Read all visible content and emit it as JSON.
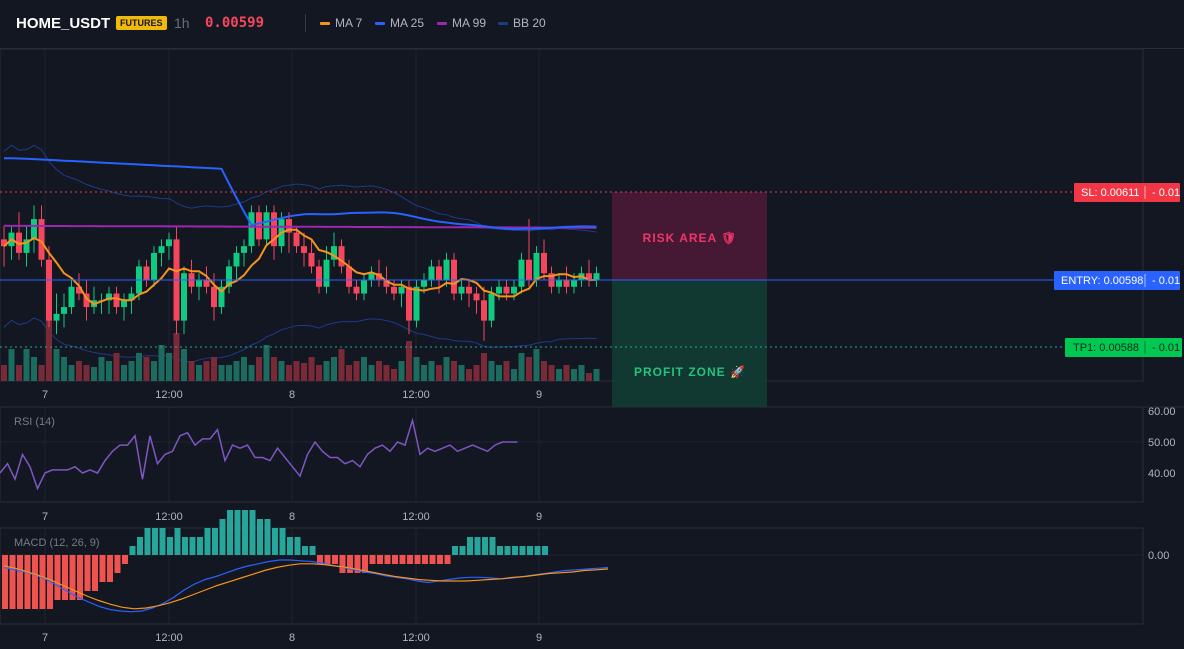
{
  "header": {
    "symbol": "HOME_USDT",
    "badge": "FUTURES",
    "timeframe": "1h",
    "price": "0.00599",
    "legend": [
      {
        "label": "MA 7",
        "color": "#f7931a"
      },
      {
        "label": "MA 25",
        "color": "#2962ff"
      },
      {
        "label": "MA 99",
        "color": "#9c27b0"
      },
      {
        "label": "BB 20",
        "color": "#1e3a8a"
      }
    ]
  },
  "levels": {
    "sl": {
      "label": "SL: 0.00611",
      "qty": "0.01",
      "value": 0.00611,
      "color": "#f23645"
    },
    "entry": {
      "label": "ENTRY: 0.00598",
      "qty": "0.01",
      "value": 0.00598,
      "color": "#2962ff"
    },
    "tp1": {
      "label": "TP1: 0.00588",
      "qty": "0.01",
      "value": 0.00588,
      "color": "#00c853"
    }
  },
  "zones": {
    "risk_label": "RISK AREA 🛡",
    "profit_label": "PROFIT ZONE 🚀"
  },
  "time_axis": [
    "7",
    "12:00",
    "8",
    "12:00",
    "9"
  ],
  "rsi_panel": {
    "title": "RSI (14)",
    "ticks": [
      "60.00",
      "50.00",
      "40.00"
    ]
  },
  "macd_panel": {
    "title": "MACD (12, 26, 9)",
    "ticks": [
      "0.00"
    ]
  },
  "chart_data": {
    "type": "candlestick",
    "price_range": [
      0.00578,
      0.00634
    ],
    "candles": [
      [
        0.00604,
        0.00606,
        0.006,
        0.00603
      ],
      [
        0.00603,
        0.00606,
        0.00601,
        0.00605
      ],
      [
        0.00605,
        0.00608,
        0.00601,
        0.00602
      ],
      [
        0.00602,
        0.00606,
        0.006,
        0.00604
      ],
      [
        0.00604,
        0.00609,
        0.00602,
        0.00607
      ],
      [
        0.00607,
        0.00609,
        0.006,
        0.00601
      ],
      [
        0.00601,
        0.00603,
        0.00591,
        0.00592
      ],
      [
        0.00592,
        0.00596,
        0.0059,
        0.00593
      ],
      [
        0.00593,
        0.00596,
        0.00591,
        0.00594
      ],
      [
        0.00594,
        0.00598,
        0.00593,
        0.00597
      ],
      [
        0.00597,
        0.00599,
        0.00595,
        0.00596
      ],
      [
        0.00596,
        0.00598,
        0.00592,
        0.00594
      ],
      [
        0.00594,
        0.00597,
        0.00593,
        0.00595
      ],
      [
        0.00595,
        0.00596,
        0.00593,
        0.00595
      ],
      [
        0.00595,
        0.00597,
        0.00593,
        0.00596
      ],
      [
        0.00596,
        0.00597,
        0.00593,
        0.00594
      ],
      [
        0.00594,
        0.00596,
        0.00592,
        0.00595
      ],
      [
        0.00595,
        0.00597,
        0.00593,
        0.00596
      ],
      [
        0.00596,
        0.00601,
        0.00595,
        0.006
      ],
      [
        0.006,
        0.00601,
        0.00597,
        0.00598
      ],
      [
        0.00598,
        0.00603,
        0.00597,
        0.00602
      ],
      [
        0.00602,
        0.00604,
        0.006,
        0.00603
      ],
      [
        0.00603,
        0.00605,
        0.00601,
        0.00604
      ],
      [
        0.00604,
        0.00606,
        0.0059,
        0.00592
      ],
      [
        0.00592,
        0.006,
        0.0059,
        0.00599
      ],
      [
        0.00599,
        0.00601,
        0.00596,
        0.00597
      ],
      [
        0.00597,
        0.00599,
        0.00595,
        0.00598
      ],
      [
        0.00598,
        0.006,
        0.00596,
        0.00597
      ],
      [
        0.00597,
        0.00599,
        0.00592,
        0.00594
      ],
      [
        0.00594,
        0.00598,
        0.00593,
        0.00597
      ],
      [
        0.00597,
        0.00601,
        0.00596,
        0.006
      ],
      [
        0.006,
        0.00603,
        0.00598,
        0.00602
      ],
      [
        0.00602,
        0.00604,
        0.006,
        0.00603
      ],
      [
        0.00603,
        0.00609,
        0.00602,
        0.00608
      ],
      [
        0.00608,
        0.00609,
        0.00603,
        0.00604
      ],
      [
        0.00604,
        0.00609,
        0.00603,
        0.00608
      ],
      [
        0.00608,
        0.00609,
        0.00601,
        0.00603
      ],
      [
        0.00603,
        0.00608,
        0.00602,
        0.00607
      ],
      [
        0.00607,
        0.00608,
        0.00602,
        0.00605
      ],
      [
        0.00605,
        0.00606,
        0.00602,
        0.00603
      ],
      [
        0.00603,
        0.00605,
        0.006,
        0.00602
      ],
      [
        0.00602,
        0.00604,
        0.00599,
        0.006
      ],
      [
        0.006,
        0.00601,
        0.00596,
        0.00597
      ],
      [
        0.00597,
        0.00603,
        0.00596,
        0.00601
      ],
      [
        0.00601,
        0.00605,
        0.006,
        0.00603
      ],
      [
        0.00603,
        0.00604,
        0.00599,
        0.006
      ],
      [
        0.006,
        0.00601,
        0.00596,
        0.00597
      ],
      [
        0.00597,
        0.00598,
        0.00595,
        0.00596
      ],
      [
        0.00596,
        0.00599,
        0.00595,
        0.00598
      ],
      [
        0.00598,
        0.006,
        0.00597,
        0.00599
      ],
      [
        0.00599,
        0.00601,
        0.00597,
        0.00598
      ],
      [
        0.00598,
        0.006,
        0.00596,
        0.00597
      ],
      [
        0.00597,
        0.00598,
        0.00595,
        0.00596
      ],
      [
        0.00596,
        0.00598,
        0.00594,
        0.00597
      ],
      [
        0.00597,
        0.00598,
        0.0059,
        0.00592
      ],
      [
        0.00592,
        0.00598,
        0.00591,
        0.00597
      ],
      [
        0.00597,
        0.00599,
        0.00596,
        0.00598
      ],
      [
        0.00598,
        0.00601,
        0.00597,
        0.006
      ],
      [
        0.006,
        0.00601,
        0.00596,
        0.00598
      ],
      [
        0.00598,
        0.00602,
        0.00597,
        0.00601
      ],
      [
        0.00601,
        0.00602,
        0.00595,
        0.00596
      ],
      [
        0.00596,
        0.00598,
        0.00595,
        0.00597
      ],
      [
        0.00597,
        0.00598,
        0.00594,
        0.00596
      ],
      [
        0.00596,
        0.00597,
        0.00593,
        0.00595
      ],
      [
        0.00595,
        0.00597,
        0.00589,
        0.00592
      ],
      [
        0.00592,
        0.00597,
        0.00591,
        0.00596
      ],
      [
        0.00596,
        0.00598,
        0.00595,
        0.00597
      ],
      [
        0.00597,
        0.00598,
        0.00595,
        0.00596
      ],
      [
        0.00596,
        0.00598,
        0.00595,
        0.00597
      ],
      [
        0.00597,
        0.00602,
        0.00596,
        0.00601
      ],
      [
        0.00601,
        0.00607,
        0.00597,
        0.00598
      ],
      [
        0.00598,
        0.00603,
        0.00597,
        0.00602
      ],
      [
        0.00602,
        0.00604,
        0.00598,
        0.00599
      ],
      [
        0.00599,
        0.006,
        0.00596,
        0.00597
      ],
      [
        0.00597,
        0.00599,
        0.00596,
        0.00598
      ],
      [
        0.00598,
        0.006,
        0.00596,
        0.00597
      ],
      [
        0.00597,
        0.00599,
        0.00596,
        0.00598
      ],
      [
        0.00598,
        0.006,
        0.00597,
        0.00599
      ],
      [
        0.00599,
        0.00601,
        0.00597,
        0.00598
      ],
      [
        0.00598,
        0.006,
        0.00597,
        0.00599
      ]
    ],
    "volume": [
      8,
      16,
      8,
      16,
      12,
      8,
      32,
      16,
      12,
      8,
      10,
      8,
      7,
      12,
      10,
      14,
      8,
      10,
      14,
      12,
      10,
      18,
      14,
      24,
      16,
      10,
      8,
      10,
      12,
      8,
      8,
      10,
      12,
      8,
      12,
      18,
      12,
      10,
      8,
      10,
      9,
      12,
      8,
      10,
      12,
      16,
      8,
      10,
      12,
      8,
      10,
      8,
      6,
      10,
      20,
      12,
      8,
      10,
      8,
      12,
      10,
      8,
      6,
      8,
      14,
      10,
      8,
      10,
      6,
      14,
      12,
      16,
      10,
      8,
      6,
      8,
      6,
      8,
      4,
      6
    ],
    "rsi": [
      40,
      43,
      38,
      46,
      42,
      35,
      40,
      41,
      41,
      41,
      42,
      40,
      41,
      40,
      44,
      47,
      49,
      49,
      52,
      38,
      52,
      43,
      46,
      47,
      52,
      53,
      49,
      51,
      51,
      54,
      44,
      49,
      48,
      49,
      45,
      45,
      44,
      48,
      45,
      42,
      39,
      46,
      50,
      47,
      45,
      45,
      43,
      44,
      42,
      46,
      48,
      49,
      47,
      50,
      49,
      57,
      46,
      48,
      47,
      48,
      49,
      47,
      48,
      49,
      48,
      47,
      49,
      50,
      50,
      50
    ],
    "macd_hist": [
      -6,
      -6,
      -6,
      -6,
      -6,
      -6,
      -6,
      -5,
      -5,
      -5,
      -5,
      -4,
      -4,
      -3,
      -3,
      -2,
      -1,
      1,
      2,
      3,
      3,
      3,
      2,
      3,
      2,
      2,
      2,
      3,
      3,
      4,
      5,
      5,
      5,
      5,
      4,
      4,
      3,
      3,
      2,
      2,
      1,
      1,
      -1,
      -1,
      -1,
      -2,
      -2,
      -2,
      -2,
      -1,
      -1,
      -1,
      -1,
      -1,
      -1,
      -1,
      -1,
      -1,
      -1,
      -1,
      1,
      1,
      2,
      2,
      2,
      2,
      1,
      1,
      1,
      1,
      1,
      1,
      1
    ],
    "macd_line": [
      -0.2,
      -0.5,
      -0.8,
      -1.2,
      -1.8,
      -2.6,
      -3.4,
      -4.2,
      -4.8,
      -5.4,
      -5.8,
      -6.0,
      -6.1,
      -6.0,
      -5.6,
      -5.0,
      -4.2,
      -3.2,
      -2.4,
      -1.8,
      -1.4,
      -0.9,
      -0.4,
      0.0,
      0.3,
      0.6,
      0.8,
      0.8,
      0.7,
      0.6,
      0.4,
      0.1,
      -0.2,
      -0.5,
      -0.8,
      -1.0,
      -1.3,
      -1.5,
      -1.7,
      -2.0,
      -2.2,
      -2.0,
      -1.8,
      -1.6,
      -1.5,
      -1.5,
      -1.6,
      -1.7,
      -1.6,
      -1.4,
      -1.2,
      -1.0,
      -0.8,
      -0.6,
      -0.5,
      -0.4,
      -0.3,
      -0.2
    ],
    "signal_line": [
      0.0,
      -0.3,
      -0.8,
      -1.3,
      -1.9,
      -2.6,
      -3.3,
      -4.0,
      -4.6,
      -5.1,
      -5.5,
      -5.7,
      -5.6,
      -5.3,
      -4.9,
      -4.4,
      -3.8,
      -3.2,
      -2.6,
      -2.1,
      -1.6,
      -1.1,
      -0.6,
      -0.2,
      0.1,
      0.3,
      0.3,
      0.2,
      0.0,
      -0.2,
      -0.5,
      -0.8,
      -1.1,
      -1.4,
      -1.6,
      -1.8,
      -1.9,
      -2.0,
      -2.0,
      -2.0,
      -1.9,
      -1.8,
      -1.7,
      -1.5,
      -1.4,
      -1.2,
      -1.0,
      -0.9,
      -0.8,
      -0.6,
      -0.5,
      -0.4
    ]
  }
}
